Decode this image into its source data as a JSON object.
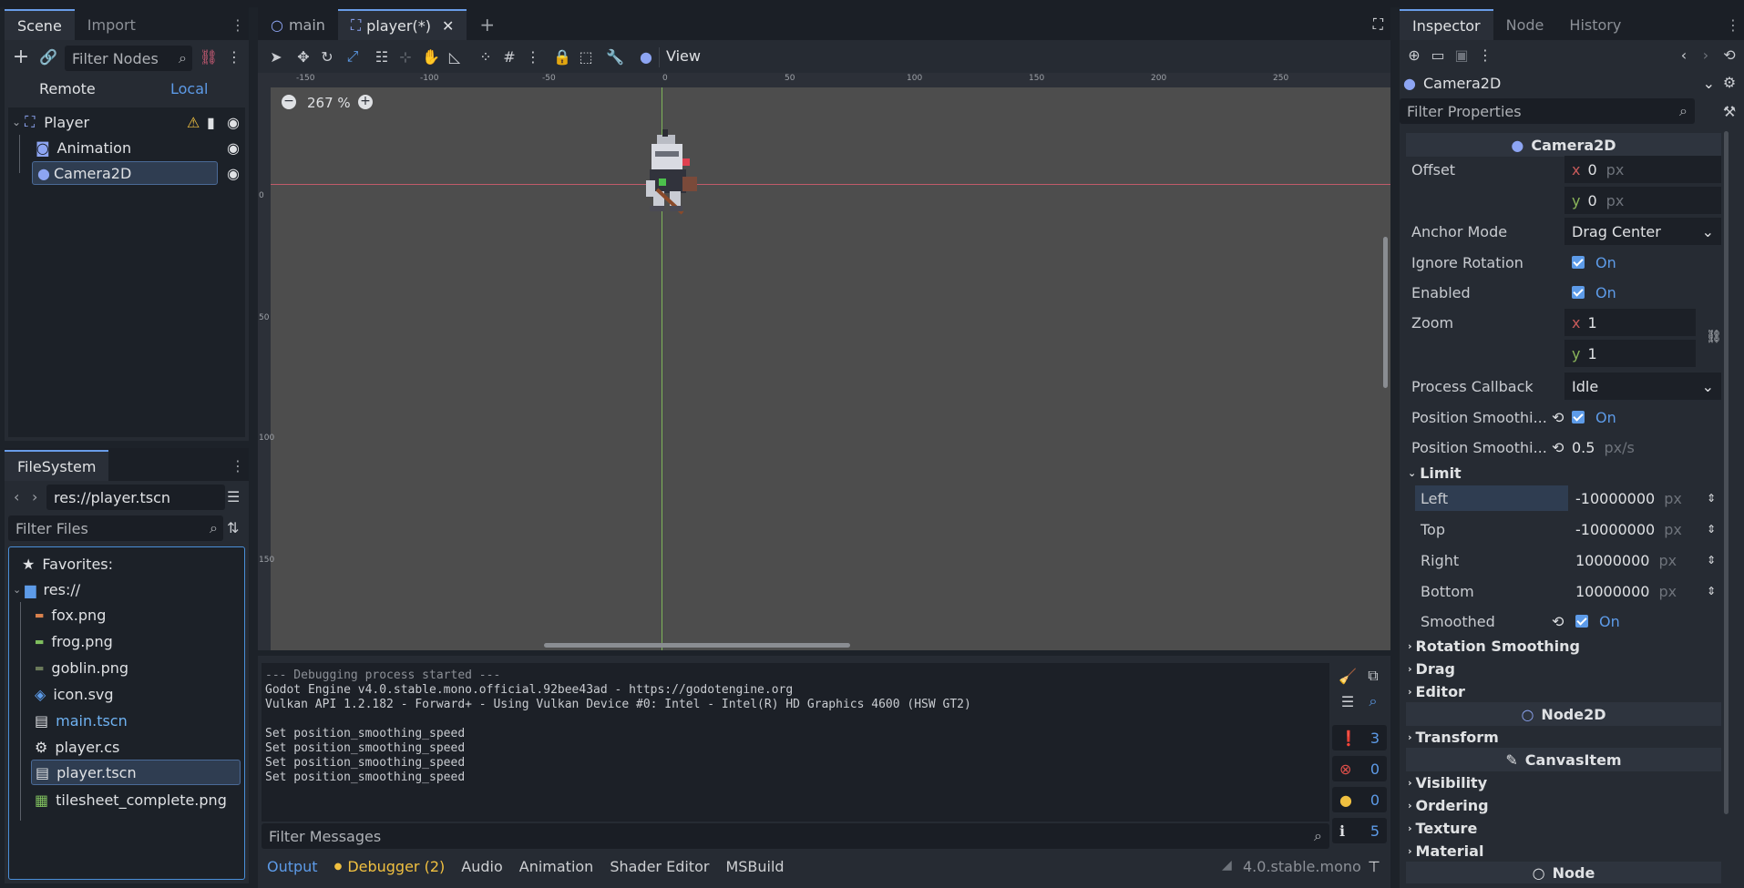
{
  "scene_panel": {
    "tabs": [
      "Scene",
      "Import"
    ],
    "filter_placeholder": "Filter Nodes",
    "remote_label": "Remote",
    "local_label": "Local",
    "nodes": [
      {
        "label": "Player",
        "icon": "node2d-icon"
      },
      {
        "label": "Animation",
        "icon": "animated-sprite-icon"
      },
      {
        "label": "Camera2D",
        "icon": "camera2d-icon"
      }
    ]
  },
  "filesystem": {
    "tab": "FileSystem",
    "path": "res://player.tscn",
    "filter_placeholder": "Filter Files",
    "favorites": "Favorites:",
    "root": "res://",
    "files": [
      "fox.png",
      "frog.png",
      "goblin.png",
      "icon.svg",
      "main.tscn",
      "player.cs",
      "player.tscn",
      "tilesheet_complete.png"
    ]
  },
  "editor": {
    "tabs": [
      "main",
      "player(*)"
    ],
    "view_label": "View",
    "zoom": "267 %",
    "ruler_top": [
      "-150",
      "-100",
      "-50",
      "0",
      "50",
      "100",
      "150",
      "200",
      "250"
    ],
    "ruler_left": [
      "0",
      "50",
      "100",
      "150"
    ]
  },
  "output": {
    "lines": [
      "--- Debugging process started ---",
      "Godot Engine v4.0.stable.mono.official.92bee43ad - https://godotengine.org",
      "Vulkan API 1.2.182 - Forward+ - Using Vulkan Device #0: Intel - Intel(R) HD Graphics 4600 (HSW GT2)",
      "",
      "Set position_smoothing_speed",
      "Set position_smoothing_speed",
      "Set position_smoothing_speed",
      "Set position_smoothing_speed"
    ],
    "filter_placeholder": "Filter Messages",
    "counters": {
      "messages": "3",
      "errors": "0",
      "warnings": "0",
      "info": "5"
    }
  },
  "bottom_tabs": [
    "Output",
    "Debugger (2)",
    "Audio",
    "Animation",
    "Shader Editor",
    "MSBuild"
  ],
  "version": "4.0.stable.mono",
  "inspector": {
    "tabs": [
      "Inspector",
      "Node",
      "History"
    ],
    "object": "Camera2D",
    "filter_placeholder": "Filter Properties",
    "class_camera": "Camera2D",
    "offset_label": "Offset",
    "offset_x": "0",
    "offset_y": "0",
    "anchor_label": "Anchor Mode",
    "anchor_value": "Drag Center",
    "ignore_rotation_label": "Ignore Rotation",
    "enabled_label": "Enabled",
    "on": "On",
    "zoom_label": "Zoom",
    "zoom_x": "1",
    "zoom_y": "1",
    "process_label": "Process Callback",
    "process_value": "Idle",
    "pos_smooth_label": "Position Smoothi...",
    "pos_smooth_speed_label": "Position Smoothi...",
    "pos_smooth_speed": "0.5",
    "speed_unit": "px/s",
    "px": "px",
    "limit_section": "Limit",
    "limit_left_label": "Left",
    "limit_left": "-10000000",
    "limit_top_label": "Top",
    "limit_top": "-10000000",
    "limit_right_label": "Right",
    "limit_right": "10000000",
    "limit_bottom_label": "Bottom",
    "limit_bottom": "10000000",
    "smoothed_label": "Smoothed",
    "sections": [
      "Rotation Smoothing",
      "Drag",
      "Editor"
    ],
    "class_node2d": "Node2D",
    "transform": "Transform",
    "class_canvasitem": "CanvasItem",
    "canvas_sections": [
      "Visibility",
      "Ordering",
      "Texture",
      "Material"
    ],
    "class_node": "Node"
  }
}
